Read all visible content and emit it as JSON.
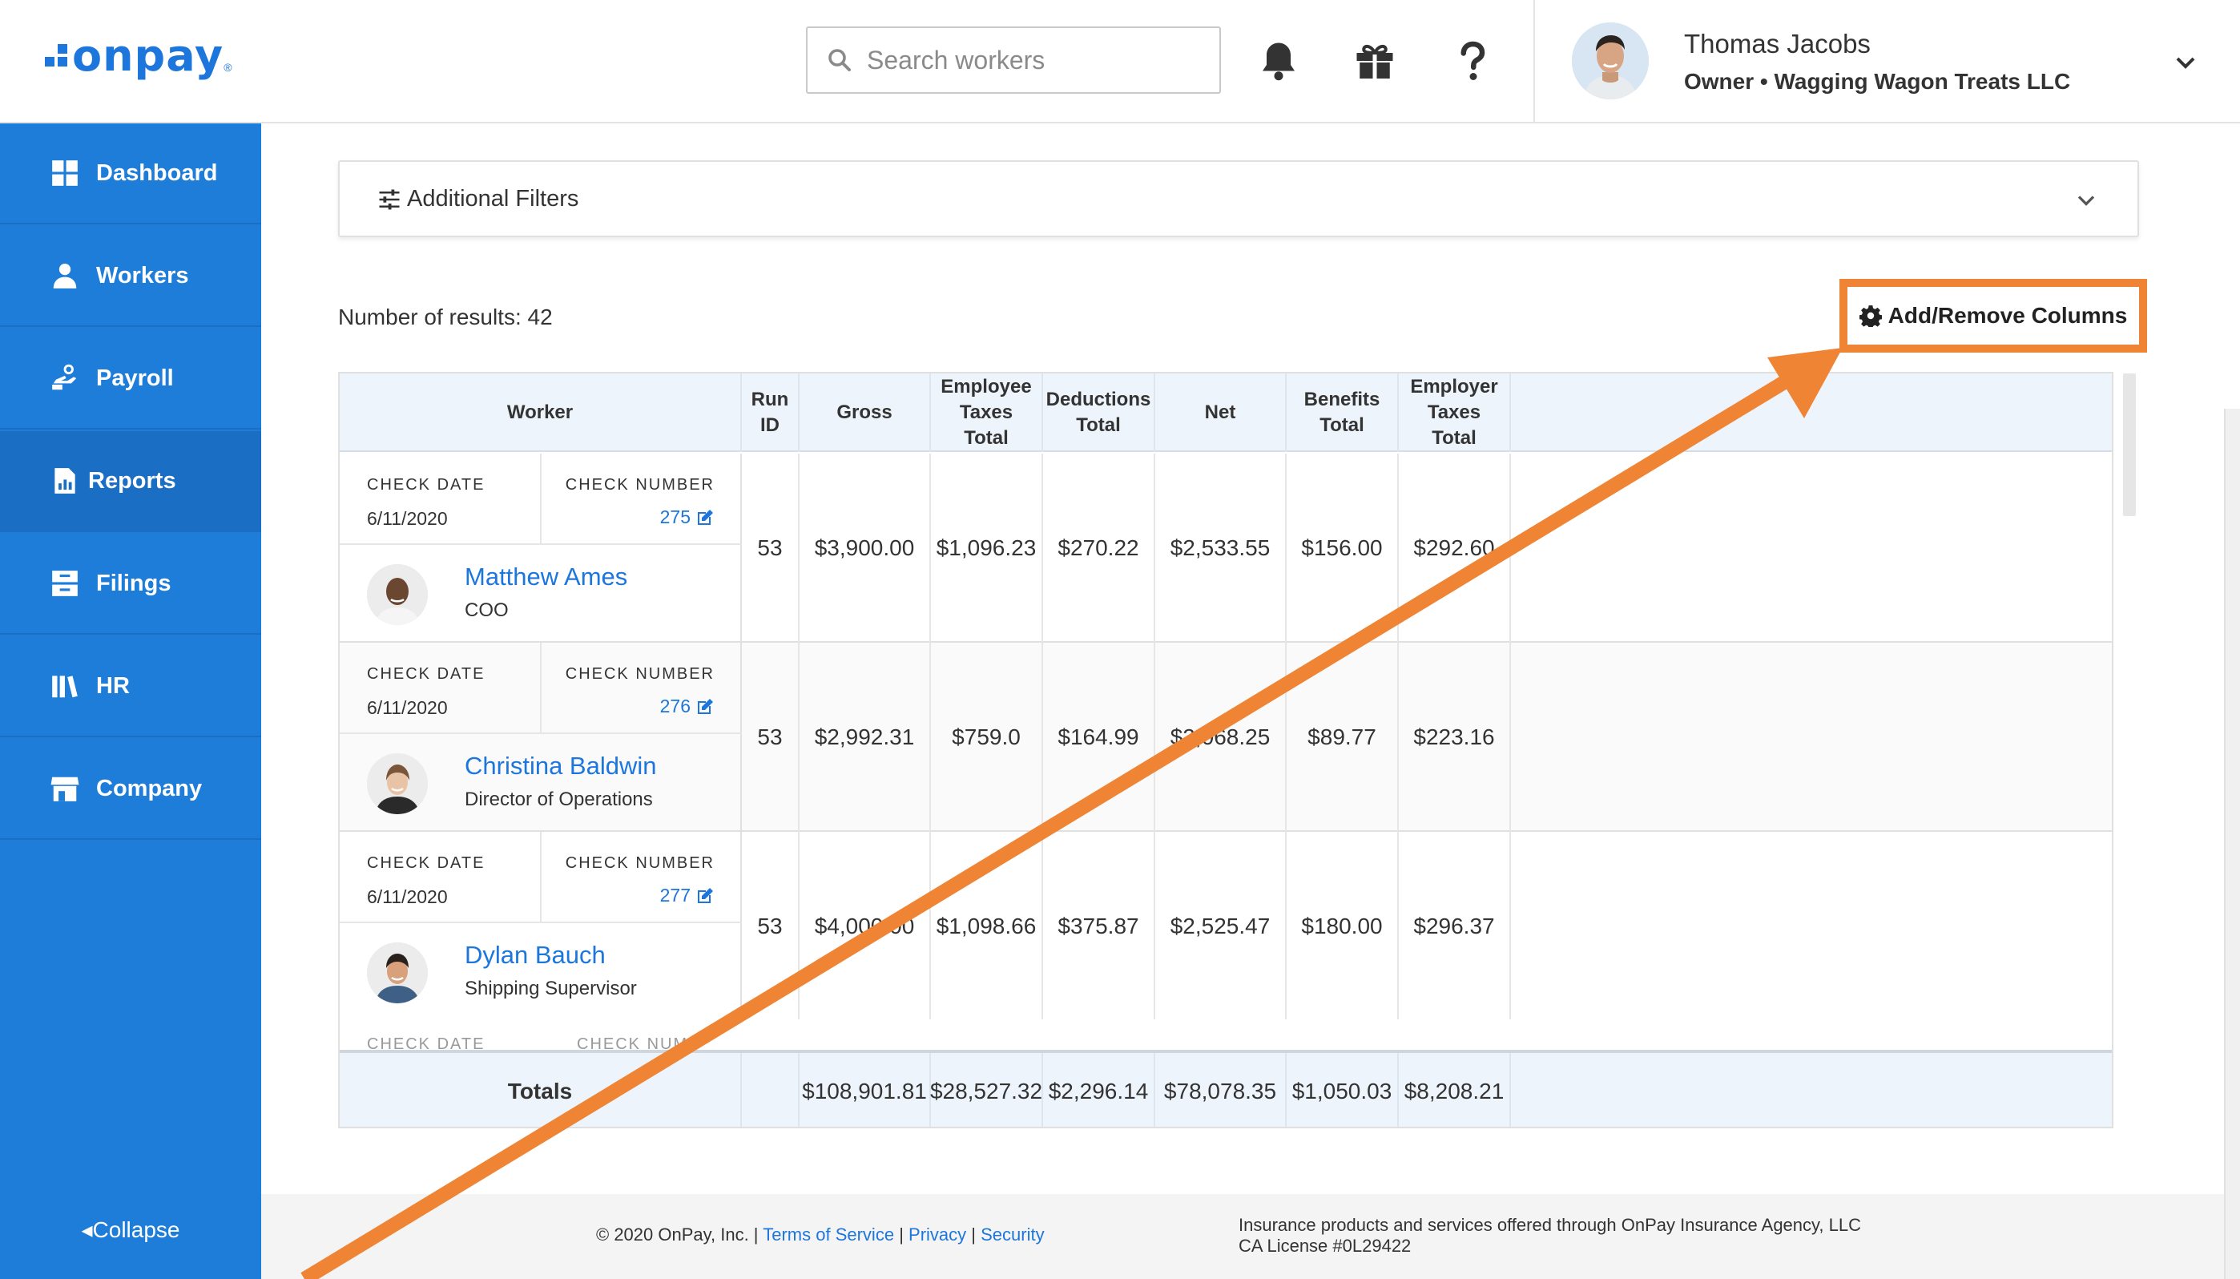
{
  "app": {
    "logo_text": "onpay",
    "logo_reg": "®"
  },
  "search": {
    "placeholder": "Search workers",
    "value": ""
  },
  "header": {
    "icons": [
      "bell-icon",
      "gift-icon",
      "help-icon"
    ],
    "user": {
      "name": "Thomas Jacobs",
      "subtitle": "Owner • Wagging Wagon Treats LLC"
    }
  },
  "sidebar": {
    "items": [
      {
        "label": "Dashboard",
        "icon": "dashboard-icon"
      },
      {
        "label": "Workers",
        "icon": "workers-icon"
      },
      {
        "label": "Payroll",
        "icon": "payroll-icon"
      },
      {
        "label": "Reports",
        "icon": "reports-icon",
        "active": true
      },
      {
        "label": "Filings",
        "icon": "filings-icon"
      },
      {
        "label": "HR",
        "icon": "hr-icon"
      },
      {
        "label": "Company",
        "icon": "company-icon"
      }
    ],
    "collapse_label": "Collapse"
  },
  "filters": {
    "label": "Additional Filters"
  },
  "results": {
    "label": "Number of results: 42"
  },
  "add_remove_columns": {
    "label": "Add/Remove Columns"
  },
  "table": {
    "headers": {
      "worker": "Worker",
      "run_id": "Run ID",
      "gross": "Gross",
      "employee_taxes_total_1": "Employee Taxes",
      "employee_taxes_total_2": "Total",
      "deductions_total": "Deductions Total",
      "net": "Net",
      "benefits_total": "Benefits Total",
      "employer_taxes_total_1": "Employer Taxes",
      "employer_taxes_total_2": "Total"
    },
    "check_date_label": "CHECK DATE",
    "check_number_label": "CHECK NUMBER",
    "rows": [
      {
        "check_date": "6/11/2020",
        "check_number": "275",
        "name": "Matthew Ames",
        "title": "COO",
        "run_id": "53",
        "gross": "$3,900.00",
        "employee_taxes": "$1,096.23",
        "deductions": "$270.22",
        "net": "$2,533.55",
        "benefits": "$156.00",
        "employer_taxes": "$292.60"
      },
      {
        "check_date": "6/11/2020",
        "check_number": "276",
        "name": "Christina Baldwin",
        "title": "Director of Operations",
        "run_id": "53",
        "gross": "$2,992.31",
        "employee_taxes": "$759.0",
        "deductions": "$164.99",
        "net": "$2,068.25",
        "benefits": "$89.77",
        "employer_taxes": "$223.16"
      },
      {
        "check_date": "6/11/2020",
        "check_number": "277",
        "name": "Dylan Bauch",
        "title": "Shipping Supervisor",
        "run_id": "53",
        "gross": "$4,000.00",
        "employee_taxes": "$1,098.66",
        "deductions": "$375.87",
        "net": "$2,525.47",
        "benefits": "$180.00",
        "employer_taxes": "$296.37"
      }
    ],
    "partial_row": {
      "check_date_label": "CHECK DATE",
      "check_number_label": "CHECK NUM"
    },
    "totals": {
      "label": "Totals",
      "gross": "$108,901.81",
      "employee_taxes": "$28,527.32",
      "deductions": "$2,296.14",
      "net": "$78,078.35",
      "benefits": "$1,050.03",
      "employer_taxes": "$8,208.21"
    }
  },
  "footer": {
    "copyright": "© 2020 OnPay, Inc. |",
    "terms": "Terms of Service",
    "sep1": "|",
    "privacy": "Privacy",
    "sep2": "|",
    "security": "Security",
    "insurance_1": "Insurance products and services offered through OnPay Insurance Agency, LLC",
    "insurance_2": "CA License #0L29422"
  },
  "colors": {
    "brand": "#1d76db",
    "sidebar": "#1f7dda",
    "sidebar_active": "#1a6fc5",
    "annotation": "#ef8534",
    "table_header": "#eef4fb"
  }
}
